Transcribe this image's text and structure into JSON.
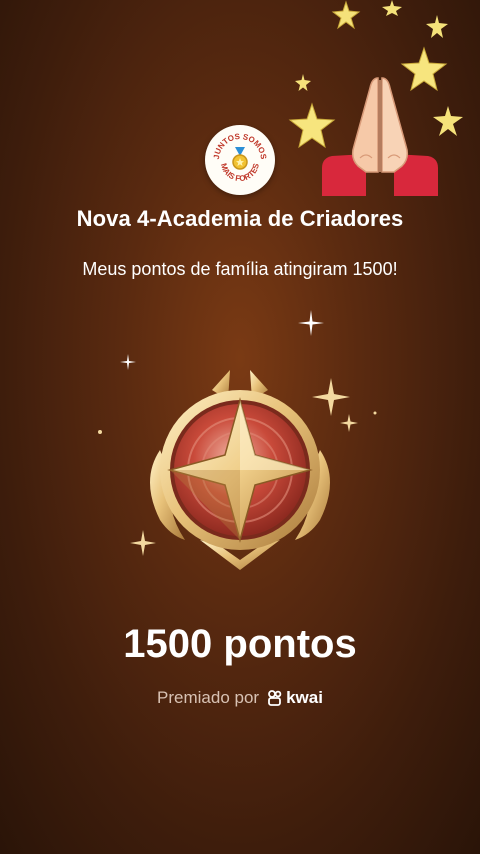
{
  "family": {
    "badge_top_text": "JUNTOS SOMOS",
    "badge_bottom_text": "MAIS FORTES",
    "name": "Nova 4-Academia de Criadores"
  },
  "message": "Meus pontos de família atingiram 1500!",
  "points": {
    "label": "1500 pontos"
  },
  "awarded": {
    "prefix": "Premiado por",
    "brand": "kwai"
  },
  "icons": {
    "praying_hands": "praying-hands-emoji",
    "badge": "gold-star-medal-icon",
    "brand_logo": "kwai-logo-icon"
  },
  "colors": {
    "background_center": "#7a3a14",
    "background_edge": "#2a1408",
    "text": "#ffffff",
    "subtext": "#d8c2b4",
    "gold": "#e8c27a",
    "badge_red": "#b5352a"
  }
}
